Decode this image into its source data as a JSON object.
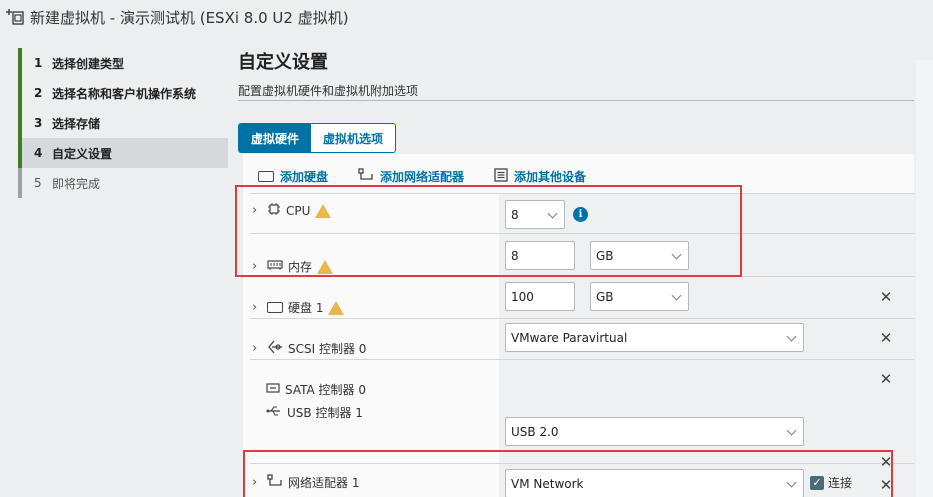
{
  "window": {
    "title": "新建虚拟机 - 演示测试机 (ESXi 8.0 U2 虚拟机)"
  },
  "wizard": {
    "steps": [
      {
        "num": "1",
        "label": "选择创建类型"
      },
      {
        "num": "2",
        "label": "选择名称和客户机操作系统"
      },
      {
        "num": "3",
        "label": "选择存储"
      },
      {
        "num": "4",
        "label": "自定义设置"
      },
      {
        "num": "5",
        "label": "即将完成"
      }
    ],
    "current_step": "4"
  },
  "main": {
    "title": "自定义设置",
    "subtitle": "配置虚拟机硬件和虚拟机附加选项",
    "tabs": [
      {
        "label": "虚拟硬件",
        "active": true
      },
      {
        "label": "虚拟机选项",
        "active": false
      }
    ],
    "add_links": {
      "hard_disk": "添加硬盘",
      "network_adapter": "添加网络适配器",
      "other_device": "添加其他设备"
    }
  },
  "hardware": {
    "cpu": {
      "label": "CPU",
      "value": "8",
      "warning": true
    },
    "memory": {
      "label": "内存",
      "value": "8",
      "unit": "GB",
      "warning": true
    },
    "hard_disk": {
      "label": "硬盘 1",
      "value": "100",
      "unit": "GB",
      "warning": true
    },
    "scsi": {
      "label": "SCSI 控制器 0",
      "value": "VMware Paravirtual"
    },
    "sata": {
      "label": "SATA 控制器 0"
    },
    "usb": {
      "label": "USB 控制器 1",
      "value": "USB 2.0"
    },
    "network": {
      "label": "网络适配器 1",
      "value": "VM Network",
      "connect_label": "连接",
      "connected": true
    }
  },
  "colors": {
    "accent": "#0072a3",
    "completed_step": "#3b7e26",
    "warning": "#e8b84a",
    "highlight": "#e0393e"
  }
}
